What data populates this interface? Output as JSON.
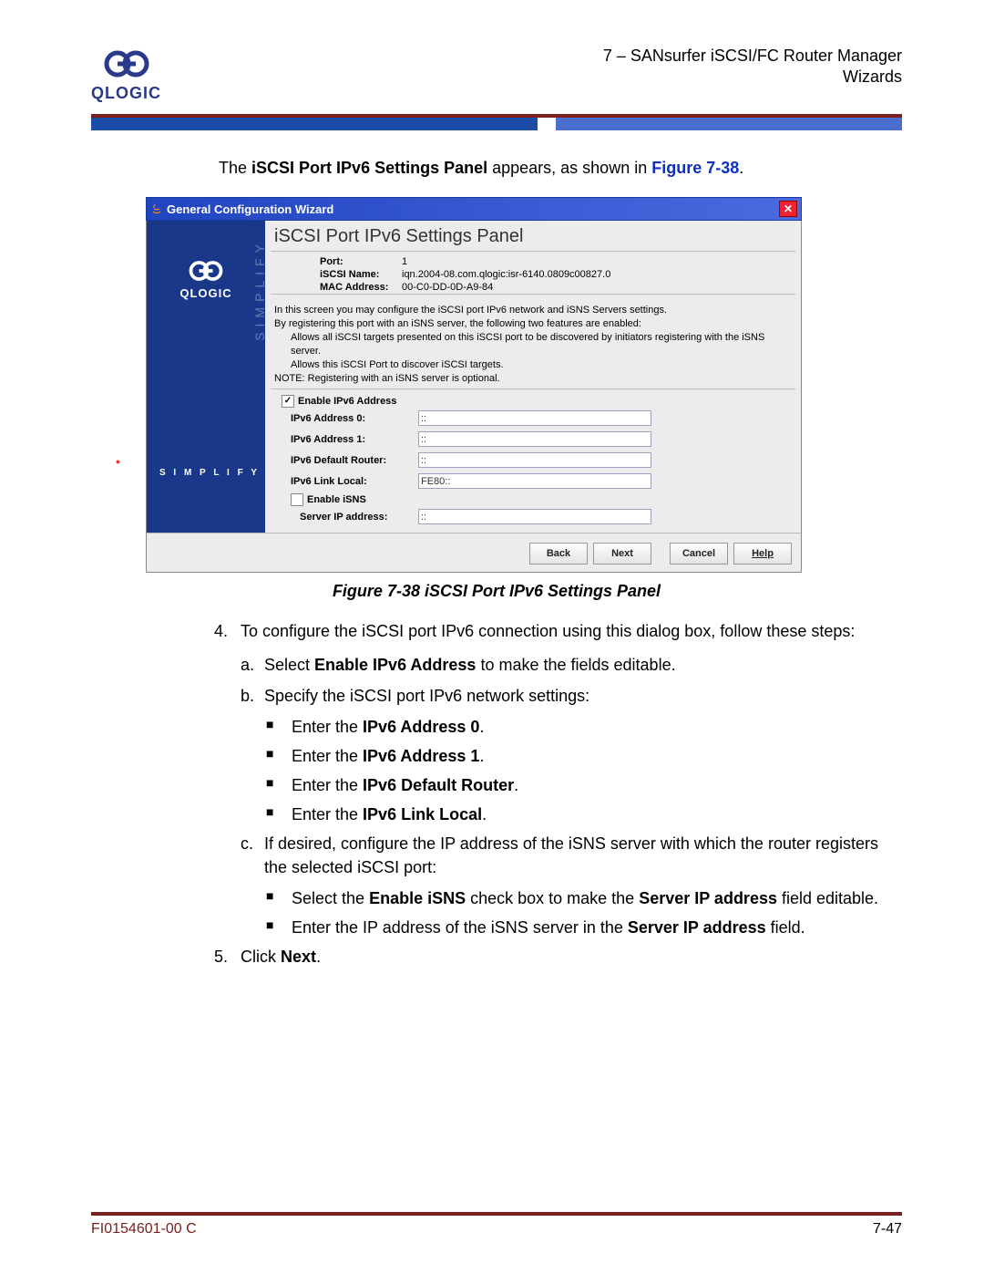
{
  "logo_text": "QLOGIC",
  "header": {
    "line1": "7 – SANsurfer iSCSI/FC Router Manager",
    "line2": "Wizards"
  },
  "intro": {
    "pre": "The ",
    "bold": "iSCSI Port IPv6 Settings Panel",
    "post": " appears, as shown in ",
    "figref": "Figure 7-38",
    "end": "."
  },
  "dialog": {
    "title": "General Configuration Wizard",
    "panel_title": "iSCSI Port IPv6 Settings Panel",
    "info": {
      "port_label": "Port:",
      "port_value": "1",
      "name_label": "iSCSI Name:",
      "name_value": "iqn.2004-08.com.qlogic:isr-6140.0809c00827.0",
      "mac_label": "MAC Address:",
      "mac_value": "00-C0-DD-0D-A9-84"
    },
    "desc": {
      "l1": "In this screen you may configure the iSCSI port IPv6 network and iSNS Servers settings.",
      "l2": "By registering this port with an iSNS server, the following two features are enabled:",
      "l3": "Allows all iSCSI targets presented on this iSCSI port to be discovered by initiators registering with the iSNS server.",
      "l4": "Allows this iSCSI Port to discover iSCSI targets.",
      "l5": "NOTE: Registering with an iSNS server is optional."
    },
    "cb_ipv6": "Enable IPv6 Address",
    "fields": {
      "addr0": "IPv6 Address 0:",
      "addr1": "IPv6 Address 1:",
      "router": "IPv6 Default Router:",
      "link": "IPv6 Link Local:",
      "link_val": "FE80::"
    },
    "cb_isns": "Enable iSNS",
    "server_label": "Server IP address:",
    "placeholder": "::",
    "buttons": {
      "back": "Back",
      "next": "Next",
      "cancel": "Cancel",
      "help": "Help"
    },
    "sidebar": {
      "brand": "QLOGIC",
      "vertical": "SIMPLIFY",
      "tagline": "S I M P L I F Y"
    }
  },
  "caption": "Figure 7-38  iSCSI Port IPv6 Settings Panel",
  "steps": {
    "s4": "To configure the iSCSI port IPv6 connection using this dialog box, follow these steps:",
    "s4a_pre": "Select ",
    "s4a_b": "Enable IPv6 Address",
    "s4a_post": " to make the fields editable.",
    "s4b": "Specify the iSCSI port IPv6 network settings:",
    "b1_pre": "Enter the ",
    "b1_b": "IPv6 Address 0",
    "b1_post": ".",
    "b2_pre": "Enter the ",
    "b2_b": "IPv6 Address 1",
    "b2_post": ".",
    "b3_pre": "Enter the ",
    "b3_b": "IPv6 Default Router",
    "b3_post": ".",
    "b4_pre": "Enter the ",
    "b4_b": "IPv6 Link Local",
    "b4_post": ".",
    "s4c": "If desired, configure the IP address of the iSNS server with which the router registers the selected iSCSI port:",
    "c1_pre": "Select the ",
    "c1_b1": "Enable iSNS",
    "c1_mid": " check box to make the ",
    "c1_b2": "Server IP address",
    "c1_post": " field editable.",
    "c2_pre": "Enter the IP address of the iSNS server in the ",
    "c2_b": "Server IP address",
    "c2_post": " field.",
    "s5_pre": "Click ",
    "s5_b": "Next",
    "s5_post": "."
  },
  "footer": {
    "doc": "FI0154601-00  C",
    "page": "7-47"
  }
}
